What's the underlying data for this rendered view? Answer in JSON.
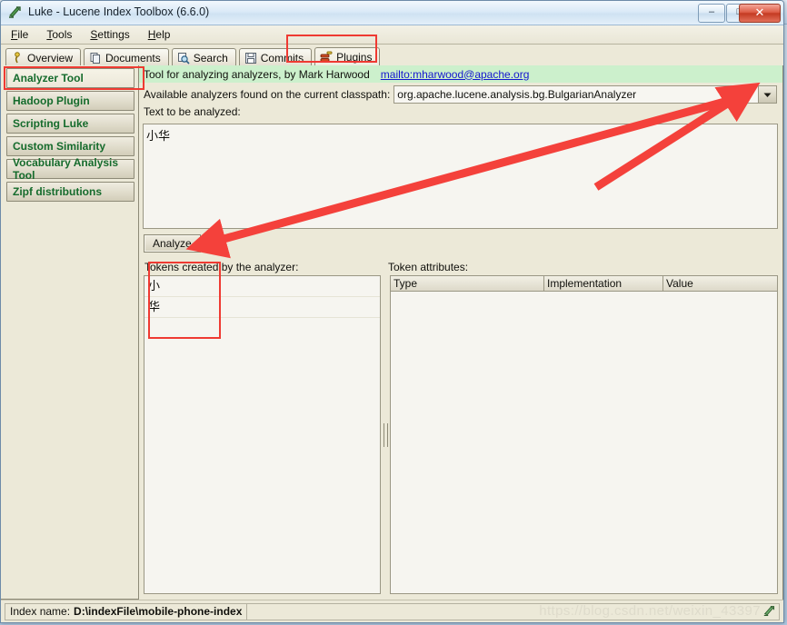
{
  "window": {
    "title": "Luke - Lucene Index Toolbox (6.6.0)",
    "icon": "luke-icon",
    "minimize_label": "–",
    "maximize_label": "□",
    "close_label": "✕"
  },
  "background_window": {
    "title": "Index name: D:\\indexFile\\mobile-phone-index"
  },
  "menubar": {
    "items": [
      {
        "label": "File",
        "mnemonic": "F"
      },
      {
        "label": "Tools",
        "mnemonic": "T"
      },
      {
        "label": "Settings",
        "mnemonic": "S"
      },
      {
        "label": "Help",
        "mnemonic": "H"
      }
    ]
  },
  "tabs": [
    {
      "label": "Overview",
      "icon": "overview-icon",
      "active": false
    },
    {
      "label": "Documents",
      "icon": "documents-icon",
      "active": false
    },
    {
      "label": "Search",
      "icon": "search-icon",
      "active": false
    },
    {
      "label": "Commits",
      "icon": "commits-icon",
      "active": false
    },
    {
      "label": "Plugins",
      "icon": "plugins-icon",
      "active": true
    }
  ],
  "plugins": {
    "items": [
      {
        "label": "Analyzer Tool",
        "selected": true
      },
      {
        "label": "Hadoop Plugin",
        "selected": false
      },
      {
        "label": "Scripting Luke",
        "selected": false
      },
      {
        "label": "Custom Similarity",
        "selected": false
      },
      {
        "label": "Vocabulary Analysis Tool",
        "selected": false
      },
      {
        "label": "Zipf distributions",
        "selected": false
      }
    ]
  },
  "analyzer_tool": {
    "banner_text": "Tool for analyzing analyzers, by Mark Harwood",
    "banner_link": "mailto:mharwood@apache.org",
    "classpath_label": "Available analyzers found on the current classpath:",
    "analyzer_value": "org.apache.lucene.analysis.bg.BulgarianAnalyzer",
    "dropdown_icon": "chevron-down-icon",
    "text_label": "Text to be analyzed:",
    "text_value": "小华",
    "analyze_button": "Analyze",
    "tokens_label": "Tokens created by the analyzer:",
    "tokens": [
      "小",
      "华"
    ],
    "attributes_label": "Token attributes:",
    "attribute_columns": [
      "Type",
      "Implementation",
      "Value"
    ],
    "attribute_rows": []
  },
  "statusbar": {
    "index_label": "Index name:",
    "index_value": "D:\\indexFile\\mobile-phone-index",
    "icon": "luke-status-icon"
  },
  "watermark": {
    "text": "https://blog.csdn.net/weixin_43397"
  },
  "colors": {
    "banner_green": "#ccf0cc",
    "link_blue": "#1417cf",
    "plugin_green": "#156b2c",
    "annotation_red": "#ef3a32",
    "window_face": "#ece9d8"
  }
}
